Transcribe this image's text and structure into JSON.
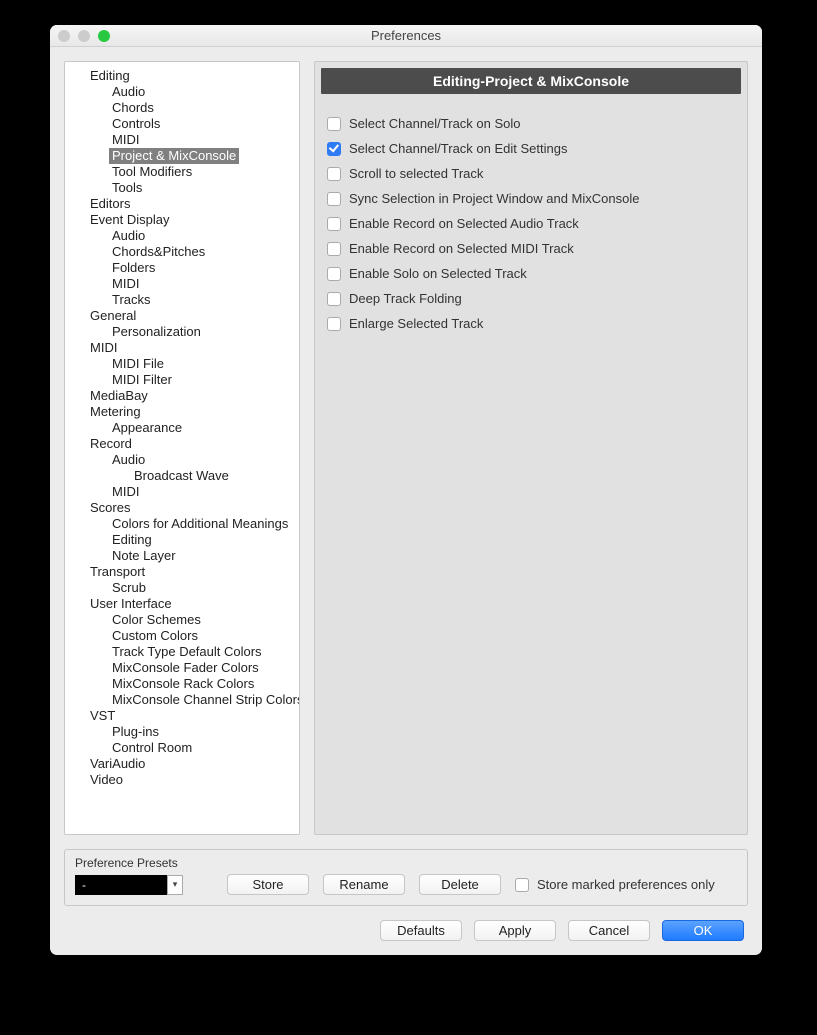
{
  "window": {
    "title": "Preferences"
  },
  "tree": [
    {
      "label": "Editing",
      "level": 0
    },
    {
      "label": "Audio",
      "level": 1
    },
    {
      "label": "Chords",
      "level": 1
    },
    {
      "label": "Controls",
      "level": 1
    },
    {
      "label": "MIDI",
      "level": 1
    },
    {
      "label": "Project & MixConsole",
      "level": 1,
      "selected": true
    },
    {
      "label": "Tool Modifiers",
      "level": 1
    },
    {
      "label": "Tools",
      "level": 1
    },
    {
      "label": "Editors",
      "level": 0
    },
    {
      "label": "Event Display",
      "level": 0
    },
    {
      "label": "Audio",
      "level": 1
    },
    {
      "label": "Chords&Pitches",
      "level": 1
    },
    {
      "label": "Folders",
      "level": 1
    },
    {
      "label": "MIDI",
      "level": 1
    },
    {
      "label": "Tracks",
      "level": 1
    },
    {
      "label": "General",
      "level": 0
    },
    {
      "label": "Personalization",
      "level": 1
    },
    {
      "label": "MIDI",
      "level": 0
    },
    {
      "label": "MIDI File",
      "level": 1
    },
    {
      "label": "MIDI Filter",
      "level": 1
    },
    {
      "label": "MediaBay",
      "level": 0
    },
    {
      "label": "Metering",
      "level": 0
    },
    {
      "label": "Appearance",
      "level": 1
    },
    {
      "label": "Record",
      "level": 0
    },
    {
      "label": "Audio",
      "level": 1
    },
    {
      "label": "Broadcast Wave",
      "level": 2
    },
    {
      "label": "MIDI",
      "level": 1
    },
    {
      "label": "Scores",
      "level": 0
    },
    {
      "label": "Colors for Additional Meanings",
      "level": 1
    },
    {
      "label": "Editing",
      "level": 1
    },
    {
      "label": "Note Layer",
      "level": 1
    },
    {
      "label": "Transport",
      "level": 0
    },
    {
      "label": "Scrub",
      "level": 1
    },
    {
      "label": "User Interface",
      "level": 0
    },
    {
      "label": "Color Schemes",
      "level": 1
    },
    {
      "label": "Custom Colors",
      "level": 1
    },
    {
      "label": "Track Type Default Colors",
      "level": 1
    },
    {
      "label": "MixConsole Fader Colors",
      "level": 1
    },
    {
      "label": "MixConsole Rack Colors",
      "level": 1
    },
    {
      "label": "MixConsole Channel Strip Colors",
      "level": 1
    },
    {
      "label": "VST",
      "level": 0
    },
    {
      "label": "Plug-ins",
      "level": 1
    },
    {
      "label": "Control Room",
      "level": 1
    },
    {
      "label": "VariAudio",
      "level": 0
    },
    {
      "label": "Video",
      "level": 0
    }
  ],
  "panel": {
    "header": "Editing-Project & MixConsole",
    "options": [
      {
        "label": "Select Channel/Track on Solo",
        "checked": false
      },
      {
        "label": "Select Channel/Track on Edit Settings",
        "checked": true
      },
      {
        "label": "Scroll to selected Track",
        "checked": false
      },
      {
        "label": "Sync Selection in Project Window and MixConsole",
        "checked": false
      },
      {
        "label": "Enable Record on Selected Audio Track",
        "checked": false
      },
      {
        "label": "Enable Record on Selected MIDI Track",
        "checked": false
      },
      {
        "label": "Enable Solo on Selected Track",
        "checked": false
      },
      {
        "label": "Deep Track Folding",
        "checked": false
      },
      {
        "label": "Enlarge Selected Track",
        "checked": false
      }
    ]
  },
  "presets": {
    "label": "Preference Presets",
    "current": "-",
    "store": "Store",
    "rename": "Rename",
    "delete": "Delete",
    "marked_only": "Store marked preferences only",
    "marked_only_checked": false
  },
  "buttons": {
    "defaults": "Defaults",
    "apply": "Apply",
    "cancel": "Cancel",
    "ok": "OK"
  }
}
